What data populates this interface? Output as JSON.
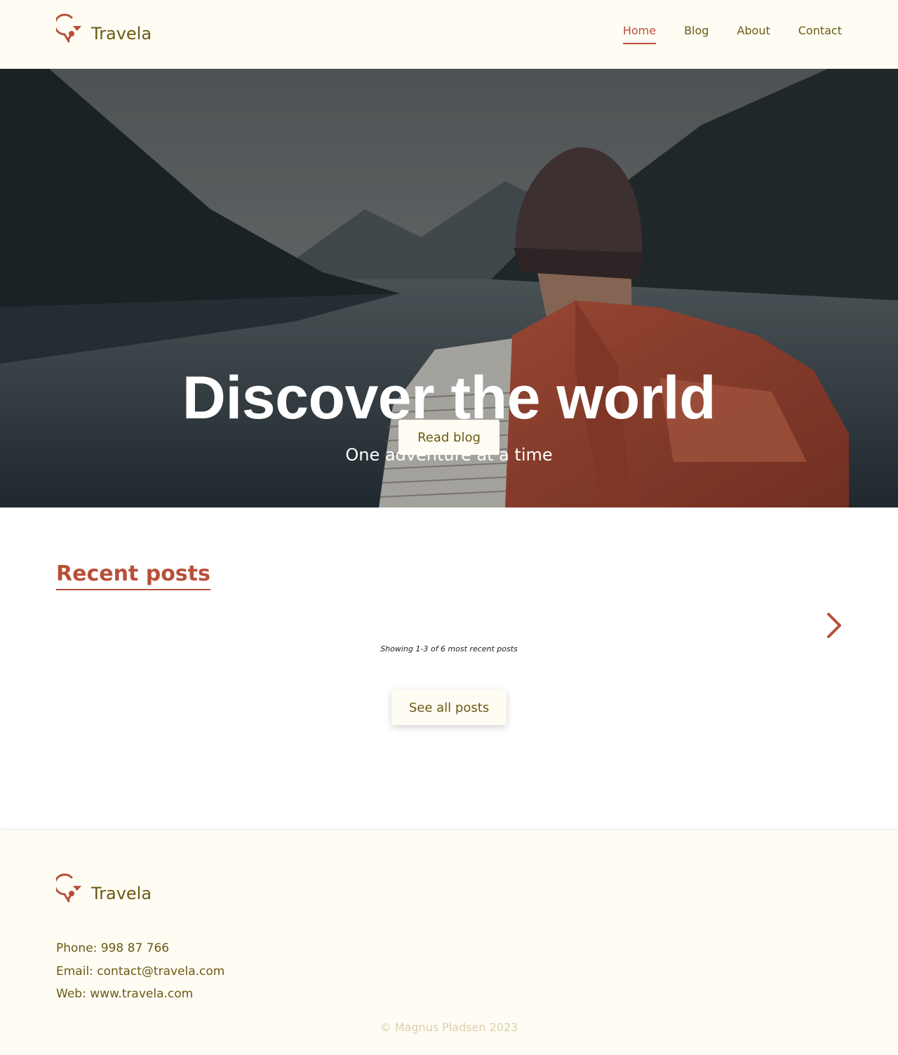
{
  "brand": {
    "name": "Travela",
    "icon": "map-pin-refresh-icon",
    "accent_color": "#b84f3b",
    "text_color": "#6b5a14"
  },
  "nav": {
    "items": [
      {
        "label": "Home",
        "active": true
      },
      {
        "label": "Blog",
        "active": false
      },
      {
        "label": "About",
        "active": false
      },
      {
        "label": "Contact",
        "active": false
      }
    ]
  },
  "hero": {
    "title": "Discover the world",
    "subtitle": "One adventure at a time",
    "button_label": "Read blog"
  },
  "recent_posts": {
    "title": "Recent posts",
    "next_icon": "chevron-right-icon",
    "showing_text": "Showing 1-3 of 6 most recent posts",
    "see_all_label": "See all posts"
  },
  "footer": {
    "brand_name": "Travela",
    "phone": "Phone: 998 87 766",
    "email": "Email: contact@travela.com",
    "web": "Web: www.travela.com",
    "copyright": "© Magnus Pladsen 2023"
  }
}
